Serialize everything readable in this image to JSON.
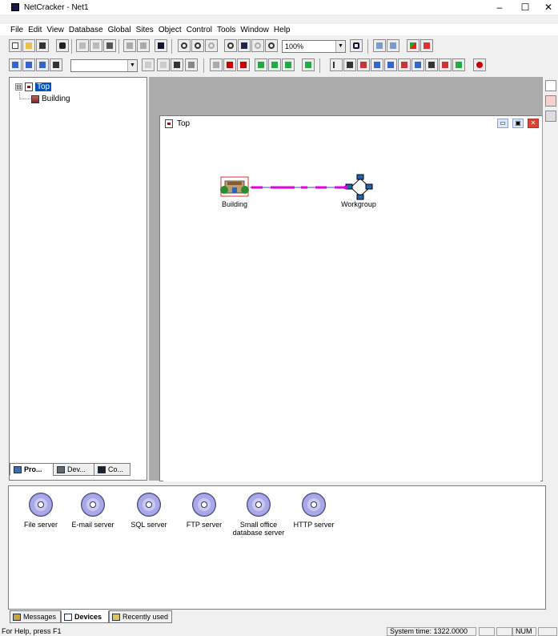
{
  "app": {
    "title": "NetCracker - Net1",
    "window_controls": {
      "minimize": "–",
      "maximize": "☐",
      "close": "✕"
    }
  },
  "menu": [
    "File",
    "Edit",
    "View",
    "Database",
    "Global",
    "Sites",
    "Object",
    "Control",
    "Tools",
    "Window",
    "Help"
  ],
  "toolbar": {
    "zoom_value": "100%",
    "object_combo": ""
  },
  "tree": {
    "root_label": "Top",
    "child_label": "Building",
    "root_expander": "⊟"
  },
  "pane_tabs": [
    {
      "label": "Pro...",
      "icon": "project-icon",
      "active": true
    },
    {
      "label": "Dev...",
      "icon": "devices-icon",
      "active": false
    },
    {
      "label": "Co...",
      "icon": "binoculars-icon",
      "active": false
    }
  ],
  "child_window": {
    "title": "Top",
    "controls": {
      "minimize": "▭",
      "restore": "▣",
      "close": "✕"
    }
  },
  "diagram": {
    "nodes": [
      {
        "label": "Building",
        "icon": "building-icon"
      },
      {
        "label": "Workgroup",
        "icon": "workgroup-icon"
      }
    ],
    "link_color": "#e000e0"
  },
  "devices": [
    {
      "label": "File server",
      "icon": "cd-disc-icon"
    },
    {
      "label": "E-mail server",
      "icon": "cd-disc-icon"
    },
    {
      "label": "SQL server",
      "icon": "cd-disc-icon"
    },
    {
      "label": "FTP server",
      "icon": "cd-disc-icon"
    },
    {
      "label": "Small office database server",
      "icon": "cd-disc-icon"
    },
    {
      "label": "HTTP server",
      "icon": "cd-disc-icon"
    }
  ],
  "bottom_tabs": [
    {
      "label": "Messages",
      "active": false
    },
    {
      "label": "Devices",
      "active": true
    },
    {
      "label": "Recently used",
      "active": false
    }
  ],
  "status": {
    "help_text": "For Help, press F1",
    "system_time": "System time: 1322.0000",
    "num_indicator": "NUM"
  }
}
